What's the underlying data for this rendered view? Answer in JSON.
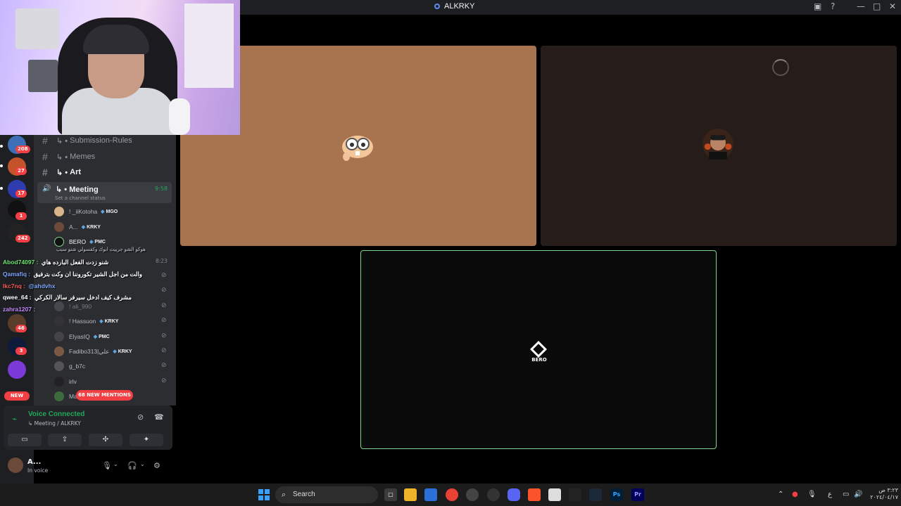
{
  "window": {
    "title": "ALKRKY"
  },
  "servers": [
    {
      "badge": "208"
    },
    {
      "badge": "27"
    },
    {
      "badge": "17"
    },
    {
      "badge": "1"
    },
    {
      "badge": "242"
    },
    {
      "badge": "46"
    },
    {
      "badge": "3"
    }
  ],
  "new_badge": "NEW",
  "channels": {
    "submission": "Submission-Rules",
    "memes": "Memes",
    "art": "Art",
    "meeting": {
      "name": "Meeting",
      "time": "9:58",
      "status": "Set a channel status"
    },
    "prefix": "↳ •"
  },
  "members": [
    {
      "name": "! _iiKotoha",
      "tag": "MGO"
    },
    {
      "name": "A...",
      "tag": "KRKY"
    },
    {
      "name": "BERO",
      "tag": "PMC"
    },
    {
      "name": "! Hassuon",
      "tag": "KRKY"
    },
    {
      "name": "ElyasIQ",
      "tag": "PMC"
    },
    {
      "name": "Fadibo313|علي",
      "tag": "KRKY"
    },
    {
      "name": "g_b7c",
      "tag": ""
    },
    {
      "name": "irlv",
      "tag": ""
    },
    {
      "name": "Ma",
      "tag": ""
    }
  ],
  "faded_member": "! ali_990",
  "faded_time": "8:23",
  "mentions_pill": "68 NEW MENTIONS",
  "chat": [
    {
      "user": "",
      "text": "هوكو الشو جربيت ابوك وكفسولي شنو سبب",
      "color": "#9aa0a6"
    },
    {
      "user": "Abod74097 :",
      "text": "شنو زدت الفعل البارده هاي",
      "color": "#6ee36e"
    },
    {
      "user": "Qamafiq :",
      "text": "والت من اجل الشير تكوروننا ان وكت بترفيق",
      "color": "#7fa8ff"
    },
    {
      "user": "lkc7nq :",
      "text": "@ahdvhx",
      "color": "#ff5a5a"
    },
    {
      "user": "qwee_64 :",
      "text": "مشرف كيف ادخل سيرفر سالار الكركي",
      "color": "#ffffff"
    },
    {
      "user": "zahra1207 :",
      "text": "",
      "color": "#c48cff"
    }
  ],
  "voice": {
    "status": "Voice Connected",
    "channel": "↳ Meeting / ALKRKY"
  },
  "user": {
    "name": "A...",
    "status": "In voice"
  },
  "stage": {
    "bero_label": "BERO"
  },
  "taskbar": {
    "search": "Search",
    "clock_time": "٣:٢٣ ص",
    "clock_date": "٢٠٢٤/٠٤/١٧"
  },
  "colors": {
    "accent_green": "#23a55a",
    "danger": "#f23f43",
    "tile_tan": "#a8744f"
  }
}
